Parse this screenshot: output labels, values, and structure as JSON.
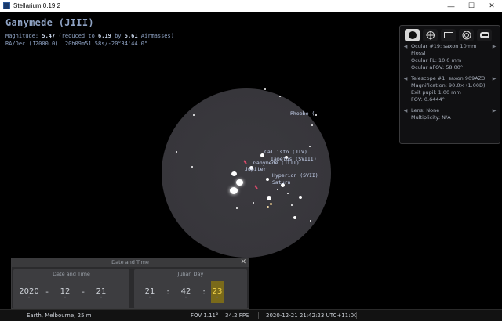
{
  "window": {
    "title": "Stellarium 0.19.2",
    "minimize": "—",
    "maximize": "☐",
    "close": "✕"
  },
  "object_info": {
    "name": "Ganymede (JIII)",
    "magnitude_label": "Magnitude: ",
    "magnitude": "5.47",
    "reduced_prefix": " (reduced to ",
    "reduced": "6.19",
    "by": " by ",
    "airmasses": "5.61",
    "airmasses_suffix": " Airmasses)",
    "radec": "RA/Dec (J2000.0): 20h09m51.58s/-20°34'44.0\""
  },
  "sky_labels": {
    "phoebe": "Phoebe (",
    "callisto": "Callisto (JIV)",
    "iapetus": "Iapetus (SVIII)",
    "ganymede": "Ganymede (JIII)",
    "jupiter": "Jupiter",
    "hyperion": "Hyperion (SVII)",
    "saturn": "Saturn"
  },
  "ocular_panel": {
    "tools": [
      "ocular-view-icon",
      "crosshair-icon",
      "ccd-frame-icon",
      "telrad-icon",
      "settings-icon"
    ],
    "ocular": "Ocular #19: saxon 10mm Plossl",
    "ocular_fl": "Ocular FL: 10.0 mm",
    "ocular_afov": "Ocular aFOV: 58.00°",
    "telescope": "Telescope #1: saxon 909AZ3",
    "magnification": "Magnification: 90.0× (1.00D)",
    "exit_pupil": "Exit pupil: 1.00 mm",
    "fov": "FOV: 0.6444°",
    "lens": "Lens: None",
    "multiplicity": "Multiplicity: N/A"
  },
  "date_dialog": {
    "title": "Date and Time",
    "close": "✕",
    "date_group": "Date and Time",
    "julian_group": "Julian Day",
    "year": "2020",
    "month": "12",
    "day": "21",
    "hour": "21",
    "minute": "42",
    "second": "23",
    "date_sep": "-",
    "time_sep": ":"
  },
  "status_bar": {
    "location": "Earth, Melbourne, 25 m",
    "fov": "FOV 1.11°",
    "fps": "34.2 FPS",
    "datetime": "2020-12-21 21:42:23 UTC+11:00"
  },
  "colors": {
    "sky": "#000000",
    "fov_circle": "#37363b",
    "label": "#8fa3c4",
    "highlight": "#f2d24a"
  }
}
